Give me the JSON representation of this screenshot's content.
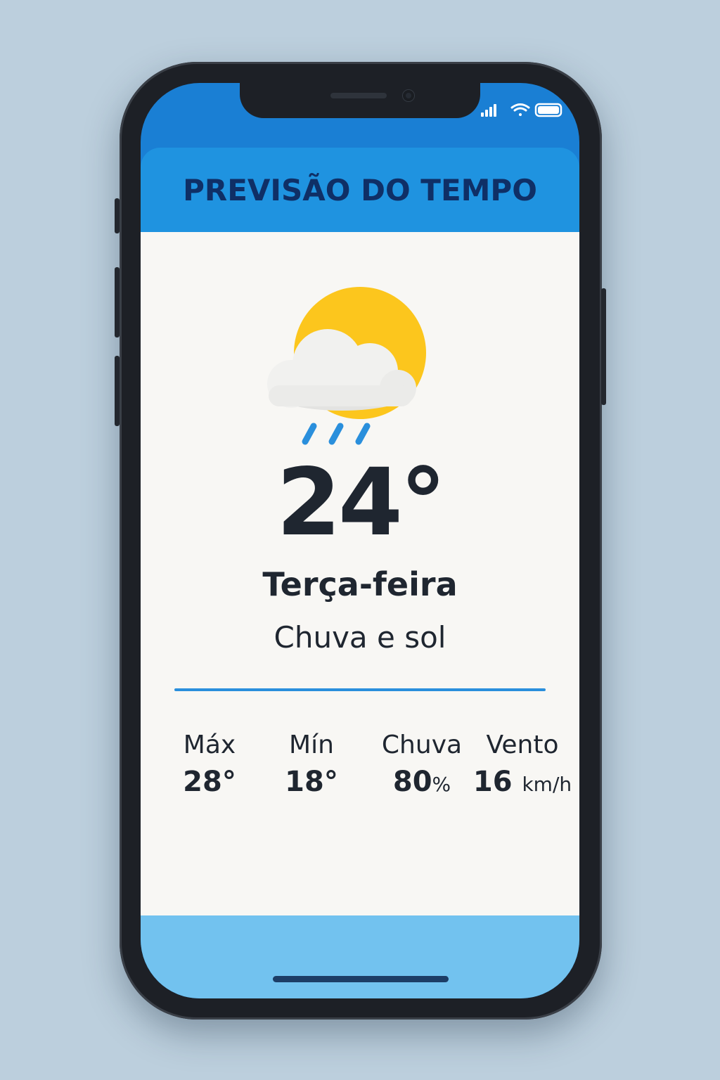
{
  "header": {
    "title": "PREVISÃO DO TEMPO"
  },
  "current": {
    "temperature": "24°",
    "day": "Terça-feira",
    "condition": "Chuva e sol",
    "icon": "sun-cloud-rain-icon"
  },
  "stats": [
    {
      "label": "Máx",
      "value": "28°",
      "unit": ""
    },
    {
      "label": "Mín",
      "value": "18°",
      "unit": ""
    },
    {
      "label": "Chuva",
      "value": "80",
      "unit": "%"
    },
    {
      "label": "Vento",
      "value": "16",
      "unit": "km/h"
    }
  ],
  "status_bar": {
    "icons": [
      "signal-icon",
      "wifi-icon",
      "battery-icon"
    ]
  },
  "colors": {
    "header": "#1f93e0",
    "title": "#0f2f66",
    "sun": "#fcc61d",
    "rain": "#2a8fdc",
    "footer": "#72c2ef",
    "background": "#f8f7f4"
  }
}
